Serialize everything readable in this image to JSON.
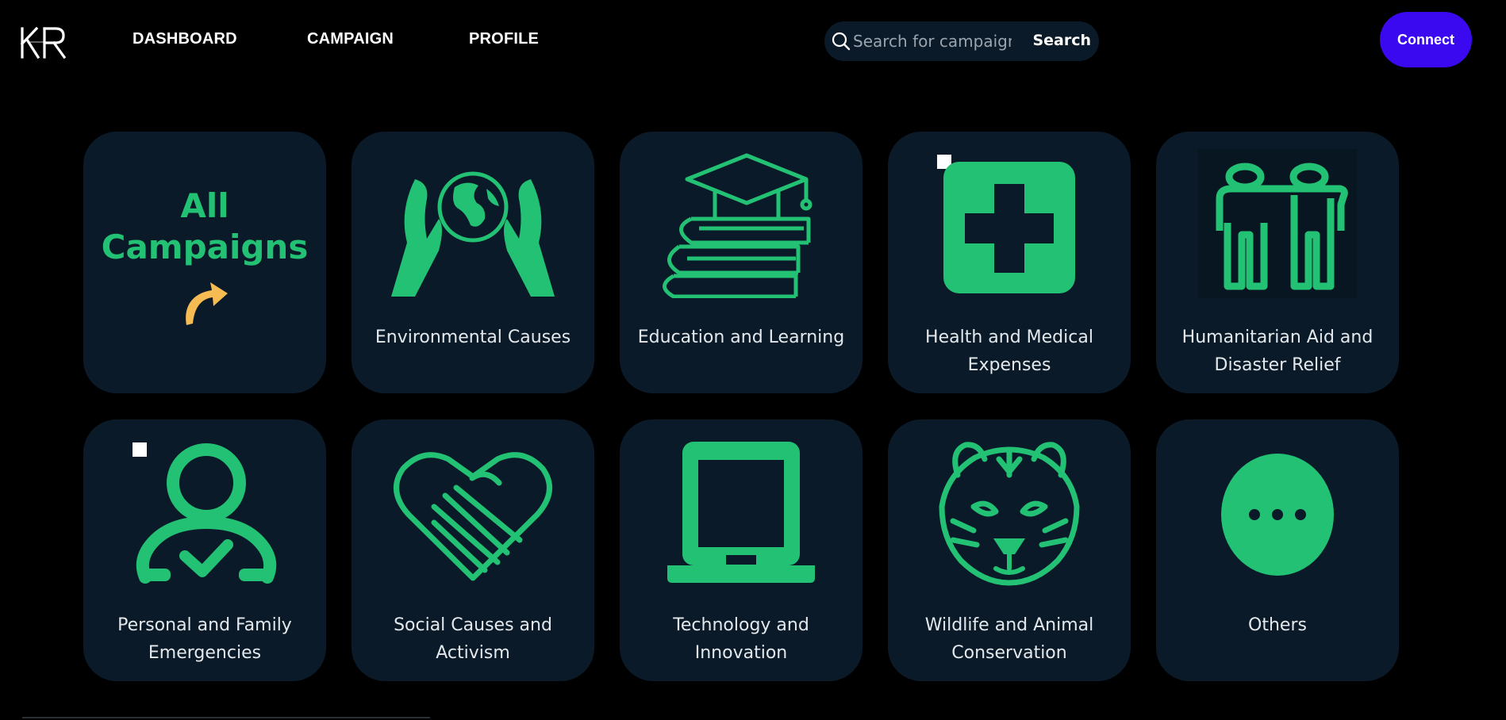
{
  "header": {
    "logo_text": "KR",
    "nav": [
      "DASHBOARD",
      "CAMPAIGN",
      "PROFILE"
    ],
    "search_placeholder": "Search for campaigns",
    "search_button": "Search",
    "connect_button": "Connect"
  },
  "colors": {
    "background": "#000000",
    "card": "#0b1a28",
    "accent_green": "#22c174",
    "connect_button": "#3b09f0",
    "arrow_orange": "#f6bb52"
  },
  "categories": [
    {
      "label": "All Campaigns",
      "icon": "curved-arrow-icon",
      "title_lines": [
        "All",
        "Campaigns"
      ]
    },
    {
      "label": "Environmental Causes",
      "icon": "hands-globe-icon"
    },
    {
      "label": "Education and Learning",
      "icon": "graduation-books-icon"
    },
    {
      "label": "Health and Medical Expenses",
      "icon": "medical-cross-icon"
    },
    {
      "label": "Humanitarian Aid and Disaster Relief",
      "icon": "people-support-icon"
    },
    {
      "label": "Personal and Family Emergencies",
      "icon": "person-check-icon"
    },
    {
      "label": "Social Causes and Activism",
      "icon": "heart-handshake-icon"
    },
    {
      "label": "Technology and Innovation",
      "icon": "laptop-icon"
    },
    {
      "label": "Wildlife and Animal Conservation",
      "icon": "tiger-icon"
    },
    {
      "label": "Others",
      "icon": "more-dots-icon"
    }
  ]
}
